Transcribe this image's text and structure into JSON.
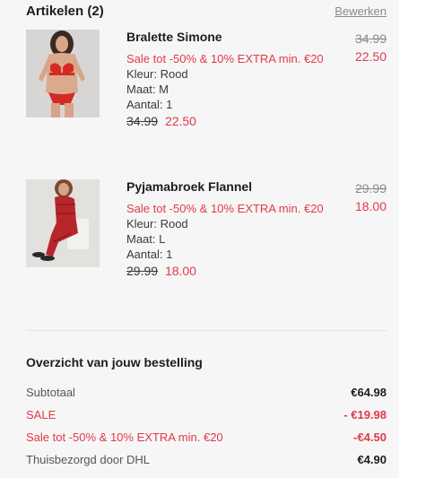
{
  "header": {
    "title": "Artikelen (2)",
    "edit_label": "Bewerken"
  },
  "items": [
    {
      "name": "Bralette Simone",
      "promo": "Sale tot -50% & 10% EXTRA min. €20",
      "color": "Kleur: Rood",
      "size": "Maat: M",
      "qty": "Aantal: 1",
      "old_price": "34.99",
      "new_price": "22.50"
    },
    {
      "name": "Pyjamabroek Flannel",
      "promo": "Sale tot -50% & 10% EXTRA min. €20",
      "color": "Kleur: Rood",
      "size": "Maat: L",
      "qty": "Aantal: 1",
      "old_price": "29.99",
      "new_price": "18.00"
    }
  ],
  "summary": {
    "title": "Overzicht van jouw bestelling",
    "rows": [
      {
        "label": "Subtotaal",
        "value": "€64.98"
      },
      {
        "label": "SALE",
        "value": "- €19.98"
      },
      {
        "label": "Sale tot -50% & 10% EXTRA min. €20",
        "value": "-€4.50"
      },
      {
        "label": "Thuisbezorgd door DHL",
        "value": "€4.90"
      }
    ]
  },
  "colors": {
    "accent_red": "#e2394b",
    "text_dark": "#1d1d1d",
    "muted": "#8a8a8a",
    "panel_bg": "#f6f6f6"
  }
}
